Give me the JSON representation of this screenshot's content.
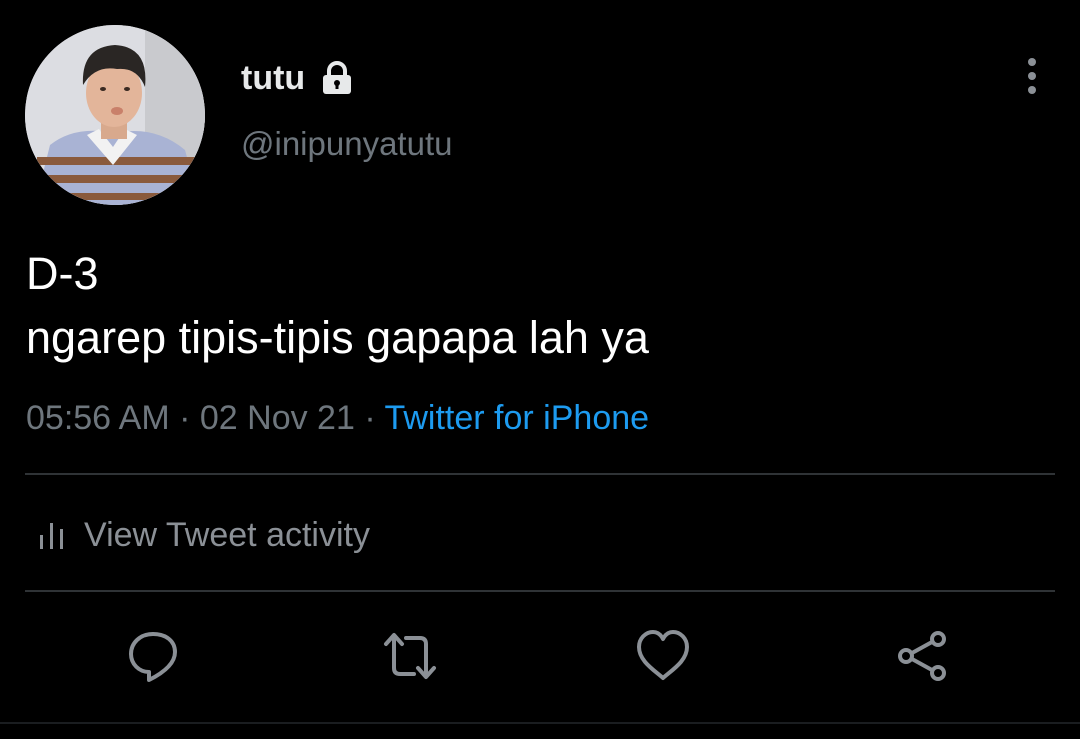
{
  "user": {
    "display_name": "tutu",
    "handle": "@inipunyatutu",
    "protected_icon": "lock-icon",
    "avatar_icon": "avatar-photo"
  },
  "tweet": {
    "lines": [
      "D-3",
      "ngarep tipis-tipis gapapa lah ya"
    ]
  },
  "meta": {
    "time": "05:56 AM",
    "sep1": " · ",
    "date": "02 Nov 21",
    "sep2": " · ",
    "source": "Twitter for iPhone"
  },
  "activity": {
    "label": "View Tweet activity",
    "icon": "bar-chart-icon"
  },
  "actions": [
    {
      "name": "reply",
      "icon": "reply-icon"
    },
    {
      "name": "retweet",
      "icon": "retweet-icon"
    },
    {
      "name": "like",
      "icon": "heart-icon"
    },
    {
      "name": "share",
      "icon": "share-icon"
    }
  ],
  "menu_icon": "more-vertical-icon",
  "colors": {
    "background": "#000000",
    "primary_text": "#e7e9ea",
    "secondary_text": "#6e767d",
    "accent": "#1d9bf0",
    "divider": "#2f3336",
    "icon": "#8b9096"
  }
}
